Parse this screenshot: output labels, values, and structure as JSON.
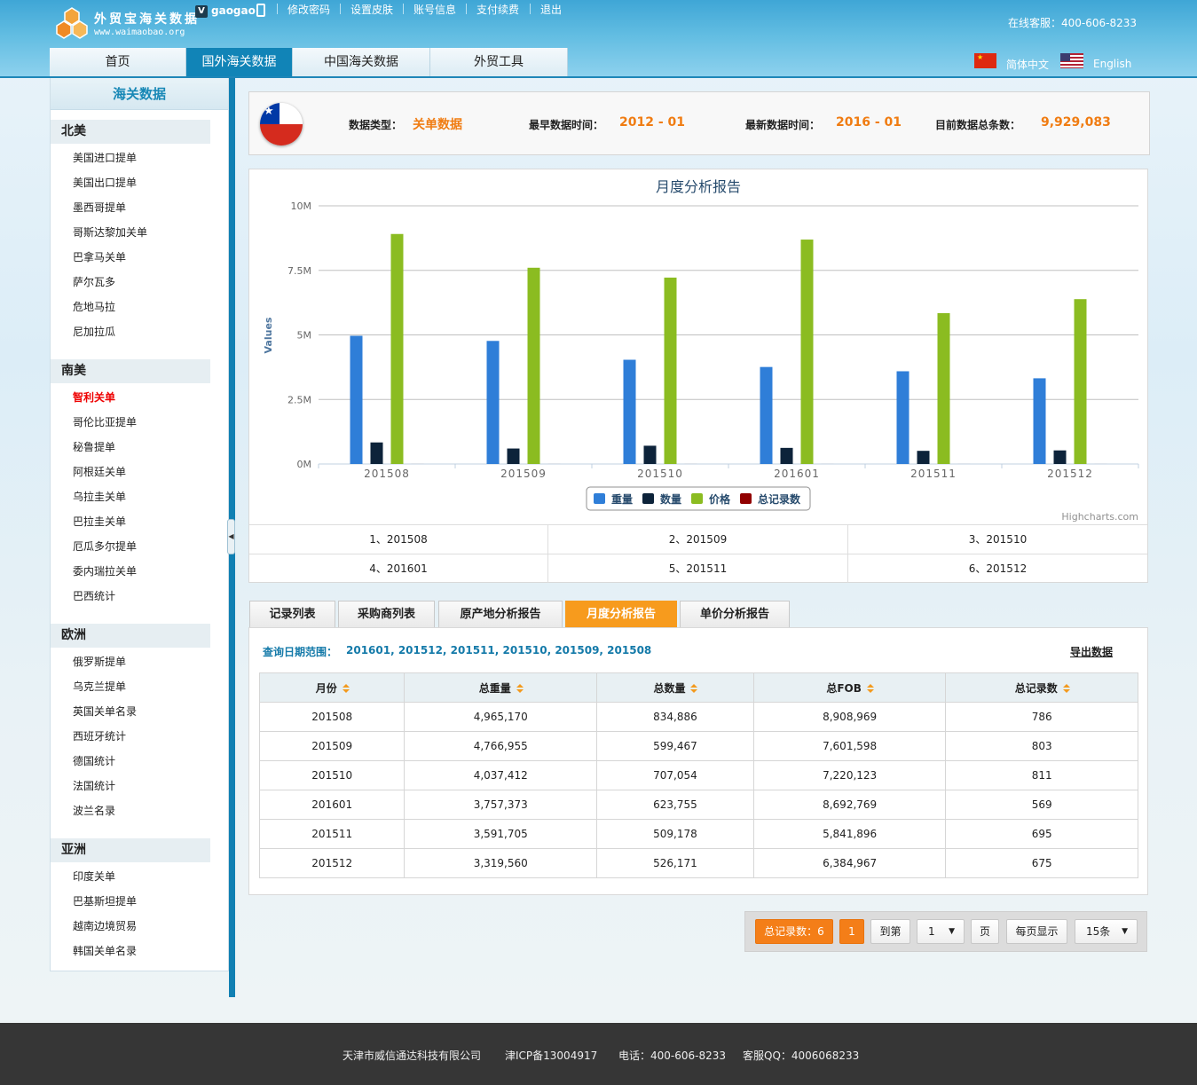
{
  "header": {
    "logo_title": "外贸宝海关数据",
    "logo_url": "www.waimaobao.org",
    "user_badge": "V",
    "username": "gaogao",
    "top_links": [
      "修改密码",
      "设置皮肤",
      "账号信息",
      "支付续费",
      "退出"
    ],
    "hotline": "在线客服：400-606-8233",
    "nav_tabs": [
      "首页",
      "国外海关数据",
      "中国海关数据",
      "外贸工具"
    ],
    "active_nav": "国外海关数据",
    "lang_cn": "简体中文",
    "lang_en": "English"
  },
  "sidebar": {
    "title": "海关数据",
    "groups": [
      {
        "name": "北美",
        "items": [
          "美国进口提单",
          "美国出口提单",
          "墨西哥提单",
          "哥斯达黎加关单",
          "巴拿马关单",
          "萨尔瓦多",
          "危地马拉",
          "尼加拉瓜"
        ]
      },
      {
        "name": "南美",
        "items": [
          "智利关单",
          "哥伦比亚提单",
          "秘鲁提单",
          "阿根廷关单",
          "乌拉圭关单",
          "巴拉圭关单",
          "厄瓜多尔提单",
          "委内瑞拉关单",
          "巴西统计"
        ]
      },
      {
        "name": "欧洲",
        "items": [
          "俄罗斯提单",
          "乌克兰提单",
          "英国关单名录",
          "西班牙统计",
          "德国统计",
          "法国统计",
          "波兰名录"
        ]
      },
      {
        "name": "亚洲",
        "items": [
          "印度关单",
          "巴基斯坦提单",
          "越南边境贸易",
          "韩国关单名录"
        ]
      }
    ],
    "active_item": "智利关单"
  },
  "info": {
    "type_label": "数据类型：",
    "type_value": "关单数据",
    "earliest_label": "最早数据时间：",
    "earliest_value": "2012 - 01",
    "latest_label": "最新数据时间：",
    "latest_value": "2016 - 01",
    "total_label": "目前数据总条数：",
    "total_value": "9,929,083"
  },
  "colors": {
    "weight": "#2f7ed8",
    "quantity": "#0d233a",
    "price": "#8bbc21",
    "records": "#910000",
    "accent": "#f47e18",
    "nav_active": "#1184b7"
  },
  "chart_data": {
    "type": "bar",
    "title": "月度分析报告",
    "ylabel": "Values",
    "xlabel": "",
    "categories": [
      "201508",
      "201509",
      "201510",
      "201601",
      "201511",
      "201512"
    ],
    "series": [
      {
        "name": "重量",
        "values": [
          4965170,
          4766955,
          4037412,
          3757373,
          3591705,
          3319560
        ]
      },
      {
        "name": "数量",
        "values": [
          834886,
          599467,
          707054,
          623755,
          509178,
          526171
        ]
      },
      {
        "name": "价格",
        "values": [
          8908969,
          7601598,
          7220123,
          8692769,
          5841896,
          6384967
        ]
      },
      {
        "name": "总记录数",
        "values": [
          786,
          803,
          811,
          569,
          695,
          675
        ]
      }
    ],
    "ylim": [
      0,
      10000000
    ],
    "yticks": [
      "0M",
      "2.5M",
      "5M",
      "7.5M",
      "10M"
    ],
    "legend_position": "bottom-center",
    "grid": true,
    "credit": "Highcharts.com"
  },
  "chart_links": [
    "1、201508",
    "2、201509",
    "3、201510",
    "4、201601",
    "5、201511",
    "6、201512"
  ],
  "report_tabs": [
    "记录列表",
    "采购商列表",
    "原产地分析报告",
    "月度分析报告",
    "单价分析报告"
  ],
  "active_report_tab": "月度分析报告",
  "query": {
    "label": "查询日期范围：",
    "value": "201601, 201512, 201511, 201510, 201509, 201508",
    "export": "导出数据"
  },
  "table": {
    "headers": [
      "月份",
      "总重量",
      "总数量",
      "总FOB",
      "总记录数"
    ],
    "rows": [
      [
        "201508",
        "4,965,170",
        "834,886",
        "8,908,969",
        "786"
      ],
      [
        "201509",
        "4,766,955",
        "599,467",
        "7,601,598",
        "803"
      ],
      [
        "201510",
        "4,037,412",
        "707,054",
        "7,220,123",
        "811"
      ],
      [
        "201601",
        "3,757,373",
        "623,755",
        "8,692,769",
        "569"
      ],
      [
        "201511",
        "3,591,705",
        "509,178",
        "5,841,896",
        "695"
      ],
      [
        "201512",
        "3,319,560",
        "526,171",
        "6,384,967",
        "675"
      ]
    ]
  },
  "pager": {
    "total": "总记录数：6",
    "current_page": "1",
    "goto": "到第",
    "page_select": "1",
    "page_unit": "页",
    "per_page_label": "每页显示",
    "per_page": "15条"
  },
  "footer": {
    "company": "天津市威信通达科技有限公司",
    "icp": "津ICP备13004917",
    "phone": "电话：400-606-8233",
    "qq": "客服QQ：4006068233"
  }
}
